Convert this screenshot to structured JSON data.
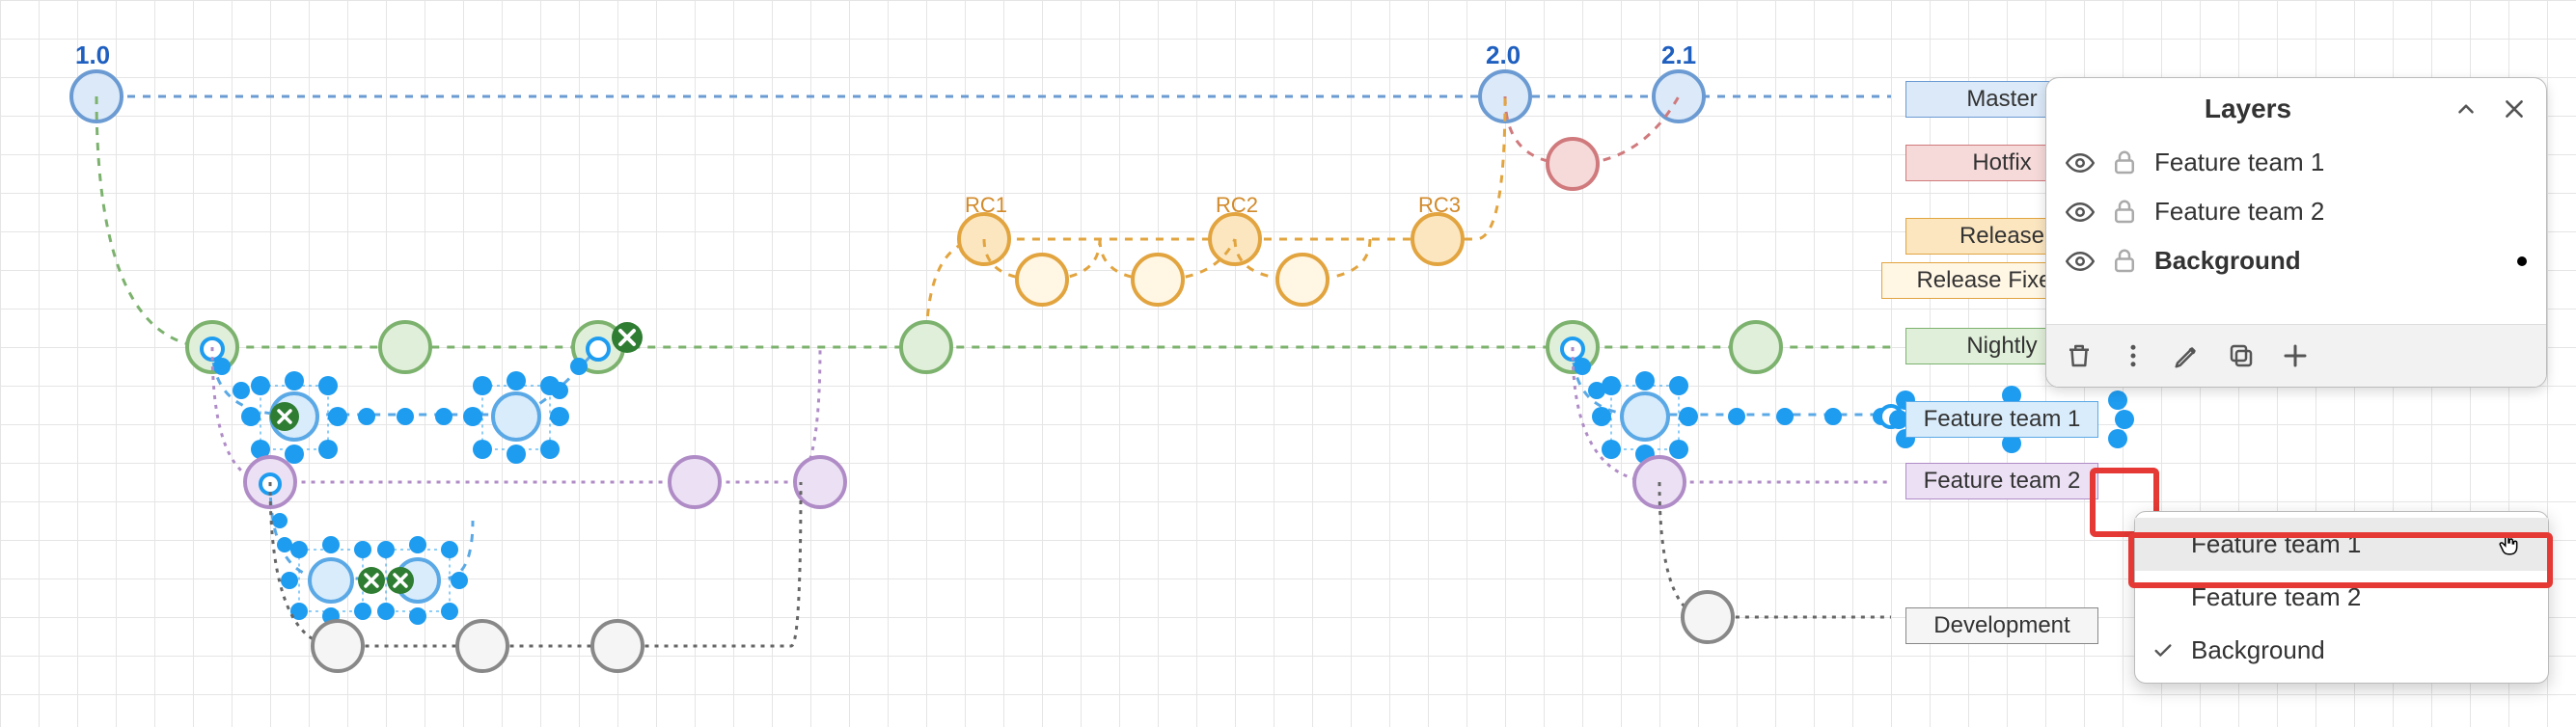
{
  "versions": {
    "v1": "1.0",
    "v2": "2.0",
    "v3": "2.1"
  },
  "releaseCandidates": {
    "rc1": "RC1",
    "rc2": "RC2",
    "rc3": "RC3"
  },
  "branches": {
    "master": "Master",
    "hotfix": "Hotfix",
    "release": "Release",
    "releaseFixes": "Release Fixes",
    "nightly": "Nightly",
    "feature1": "Feature team 1",
    "feature2": "Feature team 2",
    "development": "Development"
  },
  "layersPanel": {
    "title": "Layers",
    "items": [
      {
        "label": "Feature team 1",
        "active": false
      },
      {
        "label": "Feature team 2",
        "active": false
      },
      {
        "label": "Background",
        "active": true
      }
    ],
    "toolbar": {
      "delete": "delete",
      "more": "more",
      "edit": "edit",
      "duplicate": "duplicate",
      "add": "add"
    },
    "menu": [
      {
        "label": "Feature team 1",
        "hover": true,
        "checked": false
      },
      {
        "label": "Feature team 2",
        "hover": false,
        "checked": false
      },
      {
        "label": "Background",
        "hover": false,
        "checked": true
      }
    ]
  },
  "colors": {
    "master": "#6b9bd2",
    "hotfix": "#d07a7d",
    "release": "#e2a43f",
    "nightly": "#7cb26e",
    "feature1": "#5aa9e6",
    "feature2": "#b08cc7",
    "dev": "#888",
    "selBlue": "#1e9cf0",
    "highlight": "#e53935"
  }
}
